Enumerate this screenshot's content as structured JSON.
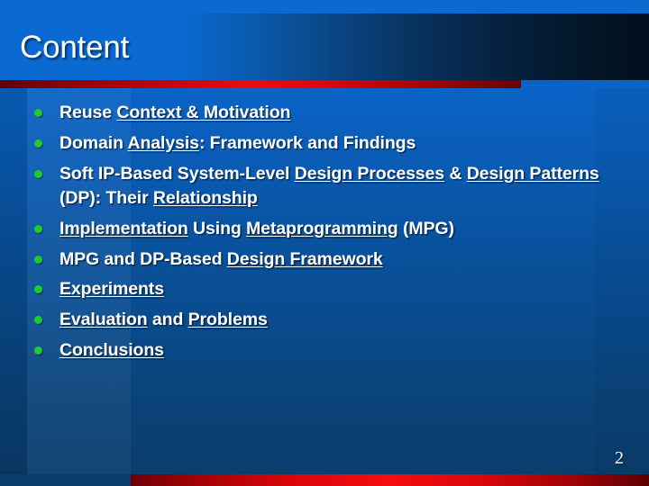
{
  "slide": {
    "title": "Content",
    "page_number": "2",
    "accent_red": "#ef0a0d",
    "header_blue": "#0a6ad2",
    "header_dark": "#020f1d",
    "bullet_green": "#1fcc2f",
    "text_color": "#ffffff"
  },
  "bullets": [
    {
      "id": "reuse-context-motivation",
      "segments": [
        {
          "text": "Reuse ",
          "underline": false
        },
        {
          "text": "Context & Motivation",
          "underline": true
        }
      ]
    },
    {
      "id": "domain-analysis",
      "segments": [
        {
          "text": "Domain ",
          "underline": false
        },
        {
          "text": "Analysis",
          "underline": true
        },
        {
          "text": ": Framework and Findings",
          "underline": false
        }
      ]
    },
    {
      "id": "soft-ip-based-design",
      "segments": [
        {
          "text": "Soft IP-Based System-Level ",
          "underline": false
        },
        {
          "text": "Design Processes",
          "underline": true
        },
        {
          "text": "  & ",
          "underline": false
        },
        {
          "text": "Design Patterns",
          "underline": true
        },
        {
          "text": " (DP): Their ",
          "underline": false
        },
        {
          "text": "Relationship",
          "underline": true
        }
      ]
    },
    {
      "id": "implementation-metaprogramming",
      "segments": [
        {
          "text": "Implementation",
          "underline": true
        },
        {
          "text": " Using ",
          "underline": false
        },
        {
          "text": "Metaprogramming",
          "underline": true
        },
        {
          "text": " (MPG)",
          "underline": false
        }
      ]
    },
    {
      "id": "mpg-dp-design-framework",
      "segments": [
        {
          "text": "MPG and DP-Based ",
          "underline": false
        },
        {
          "text": "Design Framework",
          "underline": true
        }
      ]
    },
    {
      "id": "experiments",
      "segments": [
        {
          "text": "Experiments",
          "underline": true
        }
      ]
    },
    {
      "id": "evaluation-and-problems",
      "segments": [
        {
          "text": "Evaluation",
          "underline": true
        },
        {
          "text": " and ",
          "underline": false
        },
        {
          "text": "Problems",
          "underline": true
        }
      ]
    },
    {
      "id": "conclusions",
      "segments": [
        {
          "text": "Conclusions",
          "underline": true
        }
      ]
    }
  ]
}
